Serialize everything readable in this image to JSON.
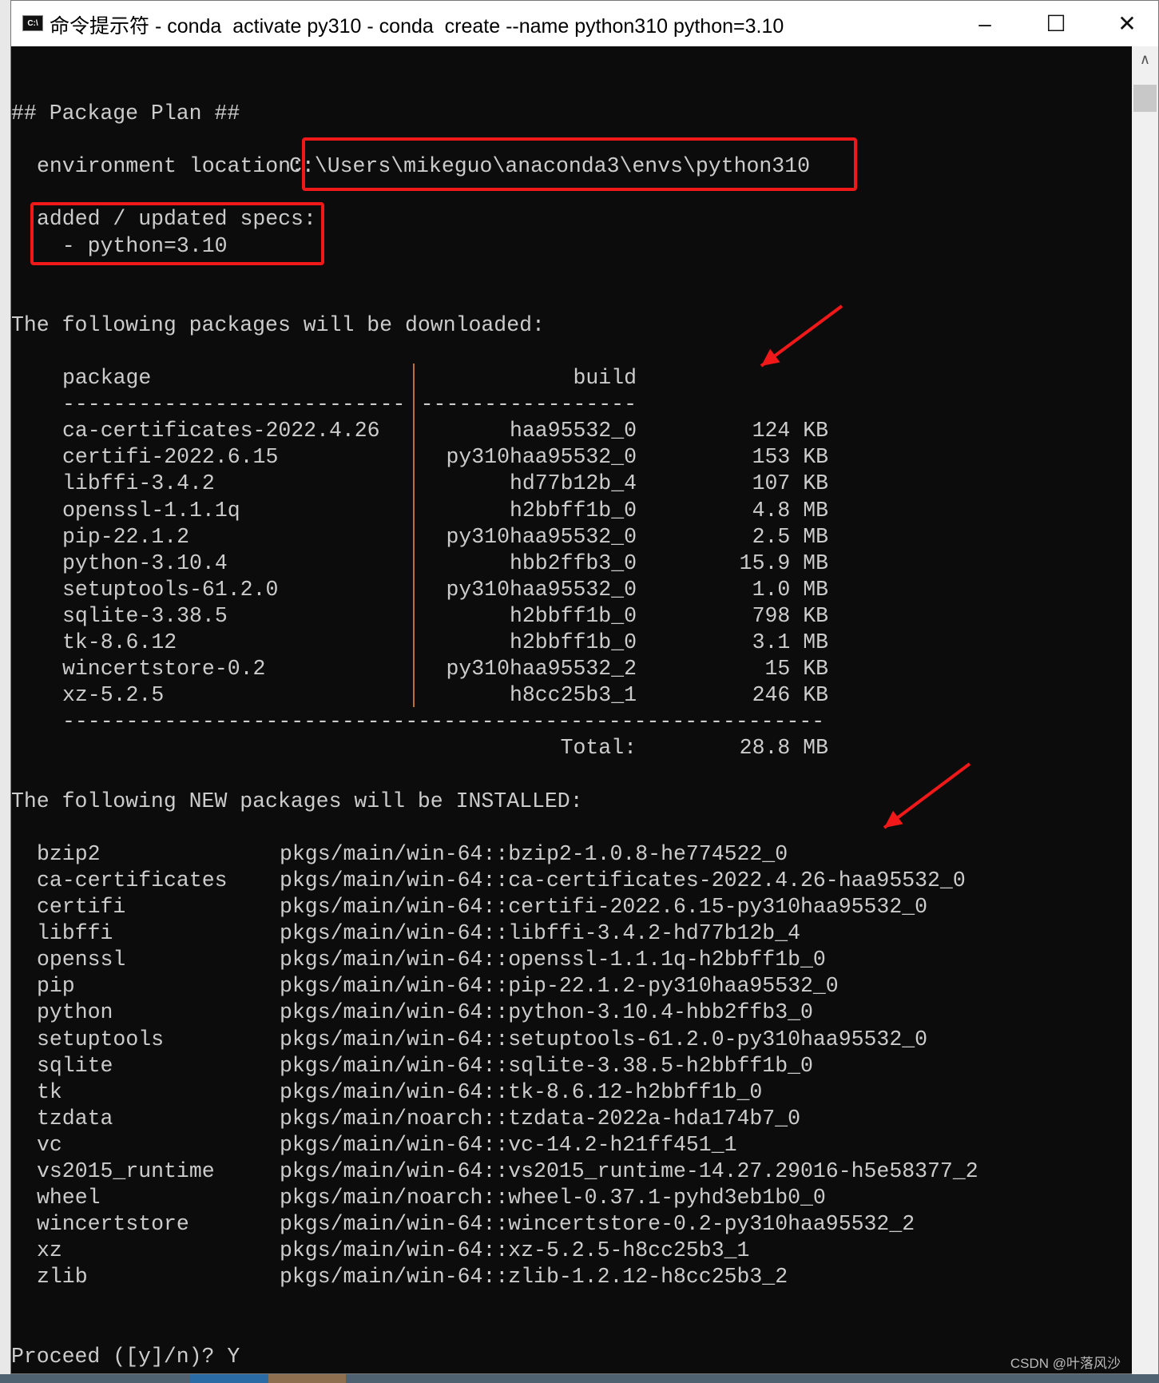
{
  "window": {
    "title": "命令提示符 - conda  activate py310 - conda  create --name python310 python=3.10",
    "icon": "cmd-icon",
    "minimize": "–",
    "maximize": "☐",
    "close": "✕"
  },
  "terminal": {
    "plan_header": "## Package Plan ##",
    "env_label": "environment location:",
    "env_path": "C:\\Users\\mikeguo\\anaconda3\\envs\\python310",
    "specs_label": "added / updated specs:",
    "specs_value": "  - python=3.10",
    "download_header": "The following packages will be downloaded:",
    "col_package": "package",
    "col_build": "build",
    "dash_package": "---------------------------",
    "dash_build": "-----------------",
    "downloads": [
      {
        "package": "ca-certificates-2022.4.26",
        "build": "haa95532_0",
        "size": "124 KB"
      },
      {
        "package": "certifi-2022.6.15",
        "build": "py310haa95532_0",
        "size": "153 KB"
      },
      {
        "package": "libffi-3.4.2",
        "build": "hd77b12b_4",
        "size": "107 KB"
      },
      {
        "package": "openssl-1.1.1q",
        "build": "h2bbff1b_0",
        "size": "4.8 MB"
      },
      {
        "package": "pip-22.1.2",
        "build": "py310haa95532_0",
        "size": "2.5 MB"
      },
      {
        "package": "python-3.10.4",
        "build": "hbb2ffb3_0",
        "size": "15.9 MB"
      },
      {
        "package": "setuptools-61.2.0",
        "build": "py310haa95532_0",
        "size": "1.0 MB"
      },
      {
        "package": "sqlite-3.38.5",
        "build": "h2bbff1b_0",
        "size": "798 KB"
      },
      {
        "package": "tk-8.6.12",
        "build": "h2bbff1b_0",
        "size": "3.1 MB"
      },
      {
        "package": "wincertstore-0.2",
        "build": "py310haa95532_2",
        "size": "15 KB"
      },
      {
        "package": "xz-5.2.5",
        "build": "h8cc25b3_1",
        "size": "246 KB"
      }
    ],
    "dash_total": "------------------------------------------------------------",
    "total_label": "Total:",
    "total_value": "28.8 MB",
    "install_header": "The following NEW packages will be INSTALLED:",
    "installs": [
      {
        "name": "bzip2",
        "spec": "pkgs/main/win-64::bzip2-1.0.8-he774522_0"
      },
      {
        "name": "ca-certificates",
        "spec": "pkgs/main/win-64::ca-certificates-2022.4.26-haa95532_0"
      },
      {
        "name": "certifi",
        "spec": "pkgs/main/win-64::certifi-2022.6.15-py310haa95532_0"
      },
      {
        "name": "libffi",
        "spec": "pkgs/main/win-64::libffi-3.4.2-hd77b12b_4"
      },
      {
        "name": "openssl",
        "spec": "pkgs/main/win-64::openssl-1.1.1q-h2bbff1b_0"
      },
      {
        "name": "pip",
        "spec": "pkgs/main/win-64::pip-22.1.2-py310haa95532_0"
      },
      {
        "name": "python",
        "spec": "pkgs/main/win-64::python-3.10.4-hbb2ffb3_0"
      },
      {
        "name": "setuptools",
        "spec": "pkgs/main/win-64::setuptools-61.2.0-py310haa95532_0"
      },
      {
        "name": "sqlite",
        "spec": "pkgs/main/win-64::sqlite-3.38.5-h2bbff1b_0"
      },
      {
        "name": "tk",
        "spec": "pkgs/main/win-64::tk-8.6.12-h2bbff1b_0"
      },
      {
        "name": "tzdata",
        "spec": "pkgs/main/noarch::tzdata-2022a-hda174b7_0"
      },
      {
        "name": "vc",
        "spec": "pkgs/main/win-64::vc-14.2-h21ff451_1"
      },
      {
        "name": "vs2015_runtime",
        "spec": "pkgs/main/win-64::vs2015_runtime-14.27.29016-h5e58377_2"
      },
      {
        "name": "wheel",
        "spec": "pkgs/main/noarch::wheel-0.37.1-pyhd3eb1b0_0"
      },
      {
        "name": "wincertstore",
        "spec": "pkgs/main/win-64::wincertstore-0.2-py310haa95532_2"
      },
      {
        "name": "xz",
        "spec": "pkgs/main/win-64::xz-5.2.5-h8cc25b3_1"
      },
      {
        "name": "zlib",
        "spec": "pkgs/main/win-64::zlib-1.2.12-h8cc25b3_2"
      }
    ],
    "prompt": "Proceed ([y]/n)? Y"
  },
  "annotation_color": "#f01818",
  "watermark": "CSDN @叶落风沙"
}
